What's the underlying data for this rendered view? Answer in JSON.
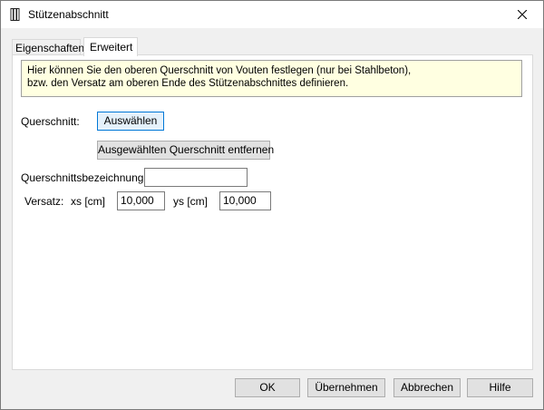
{
  "window": {
    "title": "Stützenabschnitt",
    "icon": "pillar-icon"
  },
  "tabs": [
    {
      "label": "Eigenschaften",
      "active": false
    },
    {
      "label": "Erweitert",
      "active": true
    }
  ],
  "info": {
    "line1": "Hier können Sie den oberen Querschnitt von Vouten festlegen (nur bei Stahlbeton),",
    "line2": "bzw. den Versatz am oberen Ende des Stützenabschnittes definieren."
  },
  "form": {
    "querschnitt_label": "Querschnitt:",
    "auswaehlen_label": "Auswählen",
    "entfernen_label": "Ausgewählten Querschnitt entfernen",
    "bezeichnung_label": "Querschnittsbezeichnung",
    "bezeichnung_value": "",
    "versatz_label": "Versatz:",
    "xs_label": "xs [cm]",
    "xs_value": "10,000",
    "ys_label": "ys [cm]",
    "ys_value": "10,000"
  },
  "footer": {
    "ok_label": "OK",
    "apply_label": "Übernehmen",
    "cancel_label": "Abbrechen",
    "help_label": "Hilfe"
  },
  "colors": {
    "info_background": "#ffffe1",
    "window_background": "#f0f0f0",
    "focus_border": "#0078d7"
  }
}
